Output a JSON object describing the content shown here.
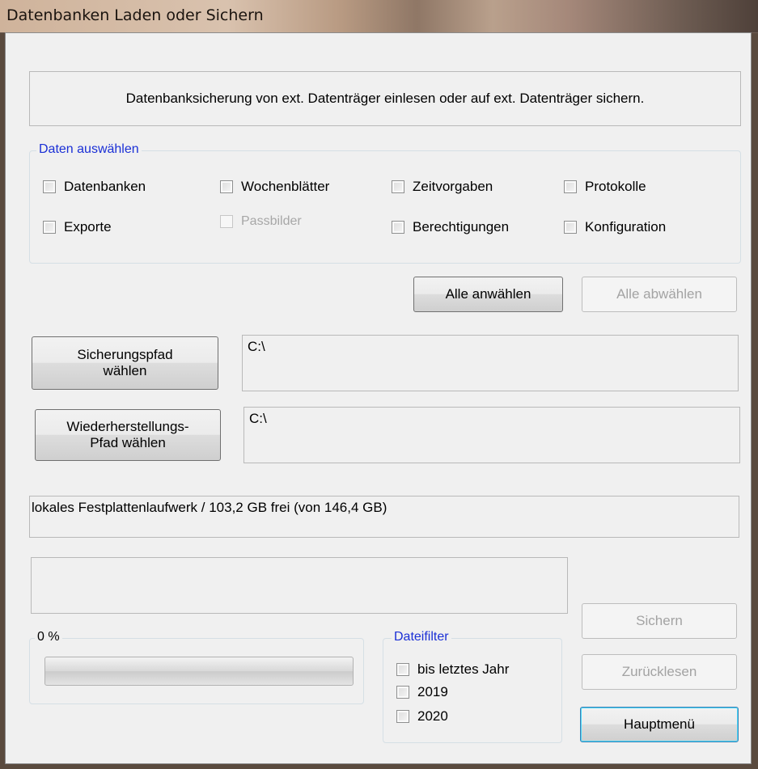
{
  "window": {
    "title": "Datenbanken Laden oder Sichern"
  },
  "description": "Datenbanksicherung von ext. Datenträger einlesen oder auf ext. Datenträger sichern.",
  "data_group": {
    "legend": "Daten auswählen",
    "items": [
      {
        "label": "Datenbanken",
        "checked": false,
        "enabled": true
      },
      {
        "label": "Wochenblätter",
        "checked": false,
        "enabled": true
      },
      {
        "label": "Zeitvorgaben",
        "checked": false,
        "enabled": true
      },
      {
        "label": "Protokolle",
        "checked": false,
        "enabled": true
      },
      {
        "label": "Exporte",
        "checked": false,
        "enabled": true
      },
      {
        "label": "Passbilder",
        "checked": false,
        "enabled": false
      },
      {
        "label": "Berechtigungen",
        "checked": false,
        "enabled": true
      },
      {
        "label": "Konfiguration",
        "checked": false,
        "enabled": true
      }
    ]
  },
  "buttons": {
    "select_all": "Alle anwählen",
    "deselect_all": "Alle abwählen",
    "backup_path": "Sicherungspfad\nwählen",
    "restore_path": "Wiederherstellungs-\nPfad wählen",
    "save": "Sichern",
    "restore": "Zurücklesen",
    "main_menu": "Hauptmenü"
  },
  "paths": {
    "backup": "C:\\",
    "restore": "C:\\"
  },
  "drive_info": "lokales Festplattenlaufwerk  /  103,2 GB frei (von 146,4 GB)",
  "status_text": "",
  "progress": {
    "label": "0 %",
    "value": 0
  },
  "file_filter": {
    "legend": "Dateifilter",
    "items": [
      {
        "label": "bis letztes Jahr",
        "checked": false
      },
      {
        "label": "2019",
        "checked": false
      },
      {
        "label": "2020",
        "checked": false
      }
    ]
  },
  "colors": {
    "group_legend_blue": "#1a2fd6",
    "progress_fill": "#06b025"
  }
}
